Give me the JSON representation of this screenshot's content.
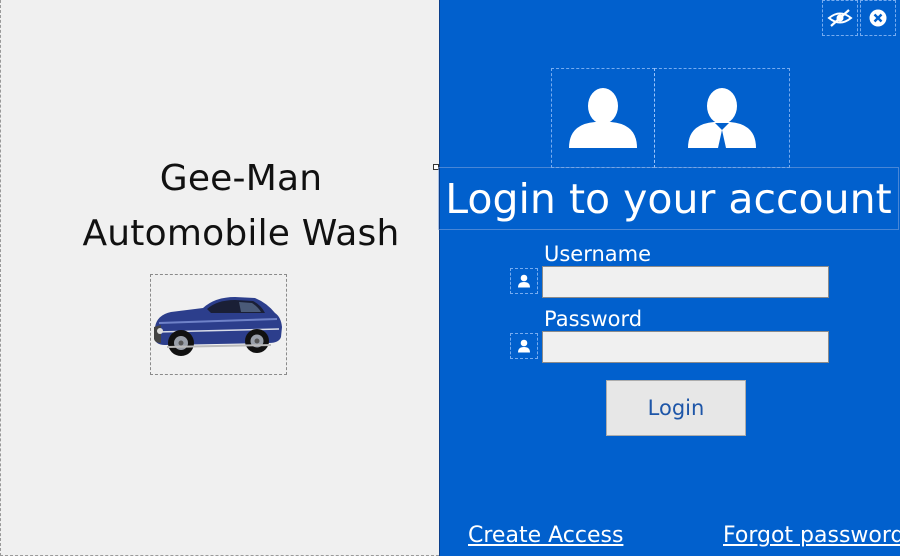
{
  "brand": {
    "line1": "Gee-Man",
    "line2": "Automobile Wash",
    "car_image_icon": "classic-car-icon"
  },
  "window": {
    "toggle_icon": "eye-toggle-icon",
    "close_icon": "close-icon"
  },
  "login": {
    "title": "Login to your account",
    "user_avatar_icon": "user-avatar-icon",
    "admin_avatar_icon": "admin-avatar-icon",
    "username_label": "Username",
    "username_value": "",
    "username_icon": "user-icon",
    "password_label": "Password",
    "password_value": "",
    "password_icon": "user-icon",
    "login_button": "Login",
    "create_access": "Create Access",
    "forgot_password": "Forgot password"
  },
  "colors": {
    "panel": "#0160cd",
    "background": "#f0f0f0",
    "button_text": "#1e56a8"
  }
}
